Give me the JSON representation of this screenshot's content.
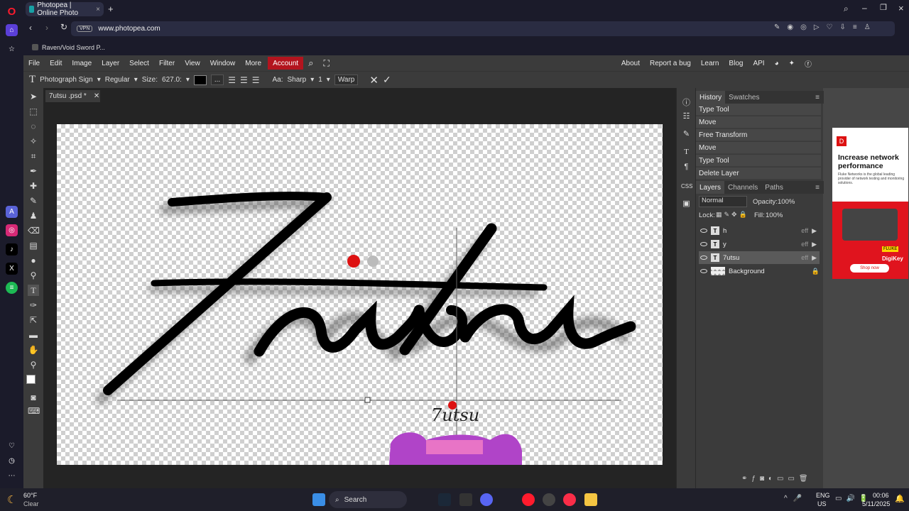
{
  "browser": {
    "tab_title": "Photopea | Online Photo",
    "url": "www.photopea.com",
    "vpn_label": "VPN",
    "bookmark": "Raven/Void Sword P..."
  },
  "menu": {
    "items": [
      "File",
      "Edit",
      "Image",
      "Layer",
      "Select",
      "Filter",
      "View",
      "Window",
      "More"
    ],
    "account": "Account",
    "right_items": [
      "About",
      "Report a bug",
      "Learn",
      "Blog",
      "API"
    ]
  },
  "options": {
    "font": "Photograph Sign",
    "style": "Regular",
    "size_label": "Size:",
    "size_value": "627.0:",
    "dots": "...",
    "aa_label": "Aa:",
    "aa_value": "Sharp",
    "tracking": "1",
    "warp": "Warp"
  },
  "document": {
    "tab_name": "7utsu .psd *",
    "canvas_text": "7utsu",
    "small_text": "7utsu"
  },
  "history": {
    "tabs": [
      "History",
      "Swatches"
    ],
    "items": [
      "Type Tool",
      "Move",
      "Free Transform",
      "Move",
      "Type Tool",
      "Delete Layer"
    ]
  },
  "layers": {
    "tabs": [
      "Layers",
      "Channels",
      "Paths"
    ],
    "blend_mode": "Normal",
    "opacity_label": "Opacity:",
    "opacity_value": "100%",
    "lock_label": "Lock:",
    "fill_label": "Fill:",
    "fill_value": "100%",
    "items": [
      {
        "name": "h",
        "kind": "T",
        "eff": "eff"
      },
      {
        "name": "y",
        "kind": "T",
        "eff": "eff"
      },
      {
        "name": "7utsu",
        "kind": "T",
        "eff": "eff"
      },
      {
        "name": "Background",
        "kind": "",
        "eff": ""
      }
    ]
  },
  "ad": {
    "headline": "Increase network performance",
    "body": "Fluke Networks is the global leading provider of network testing and monitoring solutions.",
    "brand1": "FLUKE",
    "brand2": "DigiKey",
    "cta": "Shop now"
  },
  "taskbar": {
    "weather_temp": "60°F",
    "weather_desc": "Clear",
    "search": "Search",
    "lang1": "ENG",
    "lang2": "US",
    "time": "00:06",
    "date": "5/11/2025"
  },
  "colors": {
    "accent_red": "#b3141e",
    "panel_bg": "#3b3b3b",
    "workspace_bg": "#242424"
  }
}
